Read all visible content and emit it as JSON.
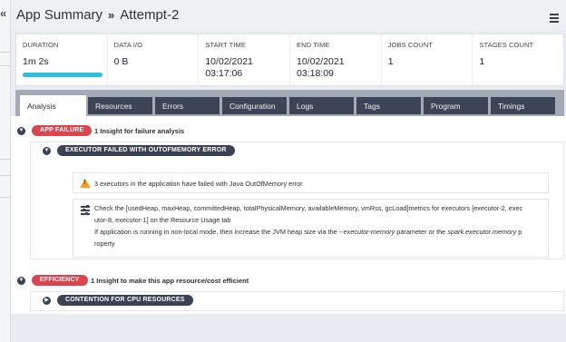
{
  "nav": {
    "collapse_label": "«"
  },
  "header": {
    "breadcrumb": {
      "app": "App Summary",
      "separator": "»",
      "attempt": "Attempt-2"
    },
    "menu_icon": "hamburger-menu-icon"
  },
  "metrics": [
    {
      "label": "DURATION",
      "value": "1m 2s"
    },
    {
      "label": "DATA I/O",
      "value": "0 B"
    },
    {
      "label": "START TIME",
      "value": "10/02/2021",
      "value2": "03:17:06"
    },
    {
      "label": "END TIME",
      "value": "10/02/2021",
      "value2": "03:18:09"
    },
    {
      "label": "JOBS COUNT",
      "value": "1"
    },
    {
      "label": "STAGES COUNT",
      "value": "1"
    }
  ],
  "tabs": [
    {
      "label": "Analysis",
      "active": true
    },
    {
      "label": "Resources"
    },
    {
      "label": "Errors"
    },
    {
      "label": "Configuration"
    },
    {
      "label": "Logs"
    },
    {
      "label": "Tags"
    },
    {
      "label": "Program"
    },
    {
      "label": "Timings"
    }
  ],
  "analysis": {
    "failure": {
      "badge": "APP FAILURE",
      "summary": "1 Insight for failure analysis",
      "category": "EXECUTOR FAILED WITH OUTOFMEMORY ERROR",
      "warning_text": "3 executors in the application have failed with Java OutOfMemory error",
      "recommendation_line1": "Check the [usedHeap, maxHeap, committedHeap, totalPhysicalMemory, availableMemory, vmRss, gcLoad]metrics for executors [executor-2, exec",
      "recommendation_line2": "utor-8, executor-1] on the Resource Usage tab",
      "recommendation_line3_pre": "If application is running in non-local mode, then increase the JVM heap size via the ",
      "recommendation_param1": "--executor-memory",
      "recommendation_line3_mid": " parameter or the ",
      "recommendation_param2": "spark.executor.memory",
      "recommendation_line3_post": " p",
      "recommendation_line4": "roperty"
    },
    "efficiency": {
      "badge": "EFFICIENCY",
      "summary": "1 Insight to make this app resource/cost efficient",
      "category": "CONTENTION FOR CPU RESOURCES"
    }
  },
  "colors": {
    "accent_bar": "#2bc0de",
    "failure_badge": "#d9464f",
    "dark_pill": "#3a4253",
    "warning": "#f2a21b"
  }
}
